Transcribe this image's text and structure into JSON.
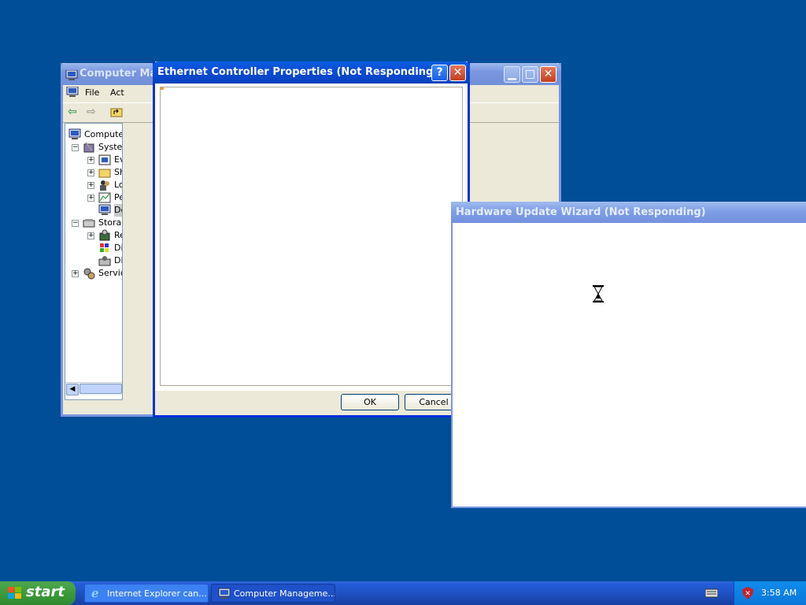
{
  "desktop": {
    "background": "#004e98"
  },
  "computer_management": {
    "title": "Computer Mana",
    "menu": {
      "file": "File",
      "action": "Act"
    },
    "tree": [
      {
        "label": "Computer",
        "icon": "computer-icon"
      },
      {
        "label": "Systen",
        "icon": "tools-icon"
      },
      {
        "label": "Ev",
        "icon": "event-viewer-icon"
      },
      {
        "label": "Sh",
        "icon": "shared-folders-icon"
      },
      {
        "label": "Lo",
        "icon": "users-icon"
      },
      {
        "label": "Pe",
        "icon": "performance-icon"
      },
      {
        "label": "De",
        "icon": "device-manager-icon"
      },
      {
        "label": "Storag",
        "icon": "storage-icon"
      },
      {
        "label": "Re",
        "icon": "removable-storage-icon"
      },
      {
        "label": "Dis",
        "icon": "defrag-icon"
      },
      {
        "label": "Dis",
        "icon": "disk-management-icon"
      },
      {
        "label": "Servic",
        "icon": "services-icon"
      }
    ]
  },
  "ethernet_dialog": {
    "title": "Ethernet Controller Properties (Not Responding)",
    "ok": "OK",
    "cancel": "Cancel"
  },
  "wizard": {
    "title": "Hardware Update Wizard (Not Responding)"
  },
  "taskbar": {
    "start": "start",
    "tasks": [
      "Internet Explorer can...",
      "Computer Manageme..."
    ],
    "clock": "3:58 AM"
  }
}
